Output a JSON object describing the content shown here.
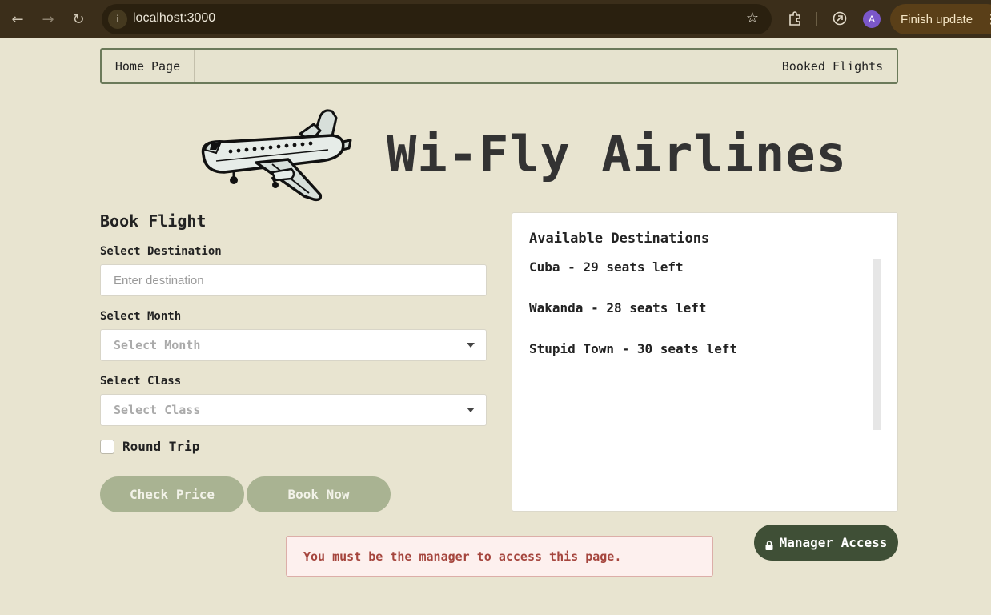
{
  "browser": {
    "url": "localhost:3000",
    "avatar_initial": "A",
    "update_label": "Finish update"
  },
  "nav": {
    "home": "Home Page",
    "booked": "Booked Flights"
  },
  "hero": {
    "title": "Wi-Fly Airlines",
    "logo_icon": "airplane-icon"
  },
  "form": {
    "title": "Book Flight",
    "destination_label": "Select Destination",
    "destination_placeholder": "Enter destination",
    "destination_value": "",
    "month_label": "Select Month",
    "month_placeholder": "Select Month",
    "class_label": "Select Class",
    "class_placeholder": "Select Class",
    "round_trip_label": "Round Trip",
    "round_trip_checked": false,
    "check_price_label": "Check Price",
    "book_now_label": "Book Now"
  },
  "destinations": {
    "title": "Available Destinations",
    "items": [
      {
        "label": "Cuba - 29 seats left"
      },
      {
        "label": "Wakanda - 28 seats left"
      },
      {
        "label": "Stupid Town - 30 seats left"
      }
    ]
  },
  "manager": {
    "button_label": "Manager Access",
    "icon": "lock-icon"
  },
  "error": {
    "message": "You must be the manager to access this page."
  },
  "colors": {
    "page_bg": "#e8e4d0",
    "button_disabled": "#a9b392",
    "manager_button": "#3f4f36",
    "error_text": "#a5453d"
  }
}
